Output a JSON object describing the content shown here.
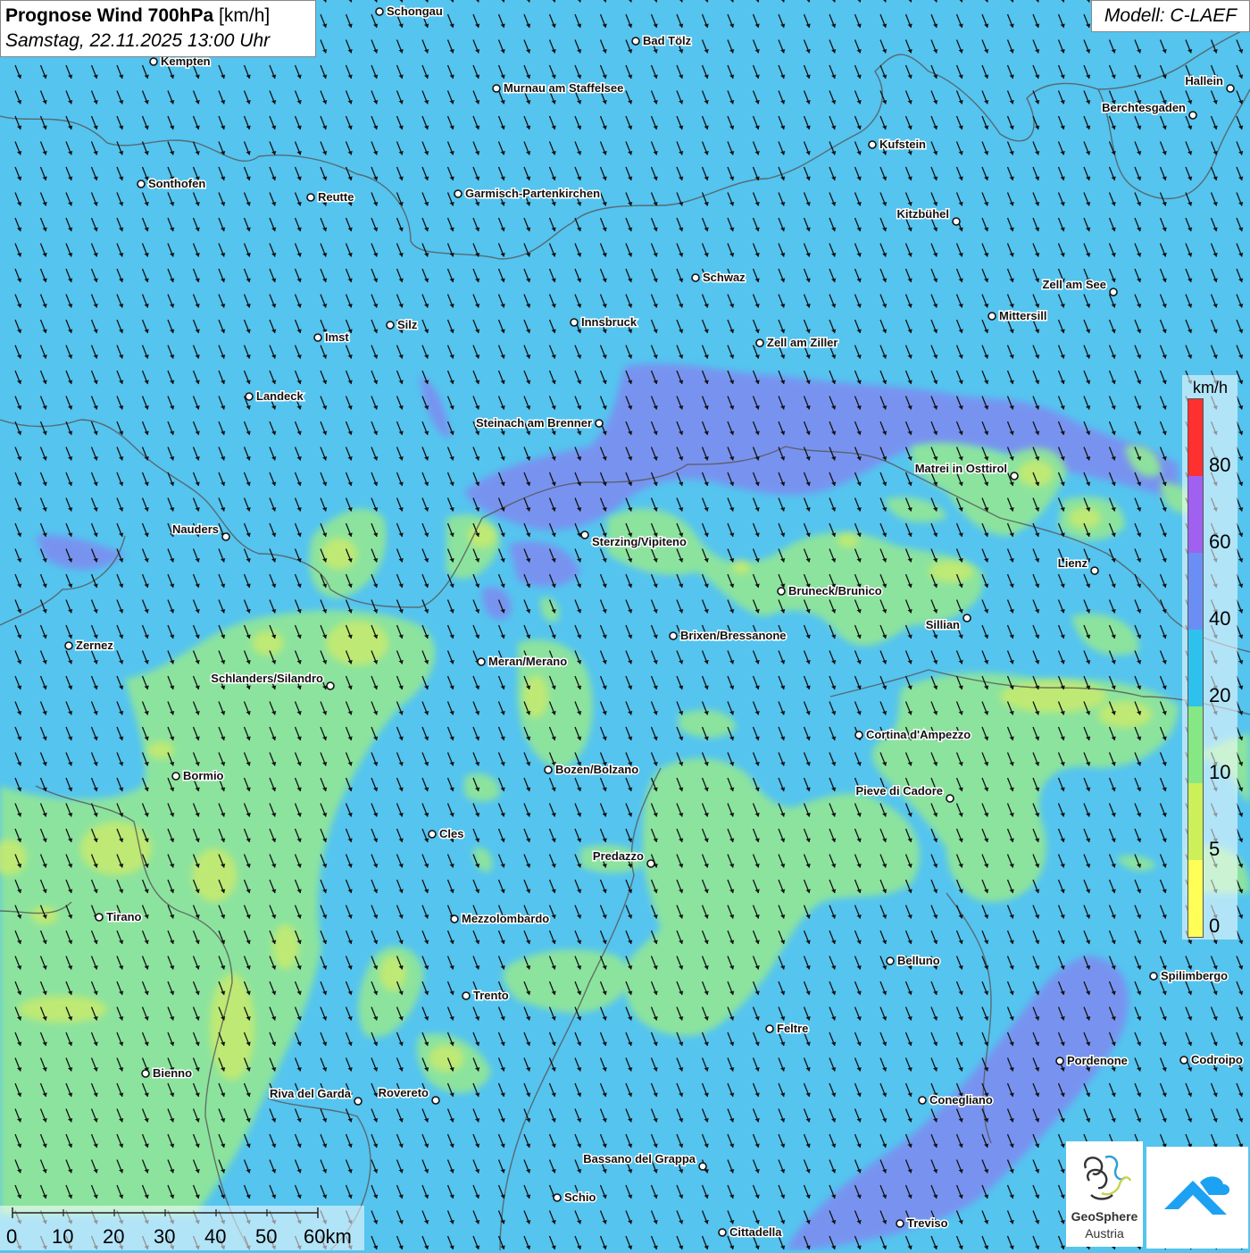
{
  "header": {
    "title_bold": "Prognose Wind 700hPa",
    "title_unit": "[km/h]",
    "datetime": "Samstag, 22.11.2025 13:00 Uhr",
    "model": "Modell: C-LAEF"
  },
  "legend": {
    "unit": "km/h",
    "ticks": [
      "80",
      "60",
      "40",
      "20",
      "10",
      "5",
      "0"
    ],
    "colors": [
      "#ff3030",
      "#a060f0",
      "#6b8ef5",
      "#2ec1ee",
      "#86e884",
      "#ccf05a",
      "#ffff58"
    ]
  },
  "scale": {
    "labels": [
      "0",
      "10",
      "20",
      "30",
      "40",
      "50",
      "60km"
    ]
  },
  "logos": {
    "geosphere_line1": "GeoSphere",
    "geosphere_line2": "Austria"
  },
  "cities": [
    {
      "name": "Schongau"
    },
    {
      "name": "Bad Tölz"
    },
    {
      "name": "Kempten"
    },
    {
      "name": "Murnau am Staffelsee"
    },
    {
      "name": "Hallein"
    },
    {
      "name": "Berchtesgaden"
    },
    {
      "name": "Kufstein"
    },
    {
      "name": "Sonthofen"
    },
    {
      "name": "Reutte"
    },
    {
      "name": "Garmisch-Partenkirchen"
    },
    {
      "name": "Kitzbühel"
    },
    {
      "name": "Schwaz"
    },
    {
      "name": "Zell am See"
    },
    {
      "name": "Mittersill"
    },
    {
      "name": "Imst"
    },
    {
      "name": "Silz"
    },
    {
      "name": "Innsbruck"
    },
    {
      "name": "Zell am Ziller"
    },
    {
      "name": "Landeck"
    },
    {
      "name": "Steinach am Brenner"
    },
    {
      "name": "Matrei in Osttirol"
    },
    {
      "name": "Nauders"
    },
    {
      "name": "Sterzing/Vipiteno"
    },
    {
      "name": "Lienz"
    },
    {
      "name": "Bruneck/Brunico"
    },
    {
      "name": "Sillian"
    },
    {
      "name": "Zernez"
    },
    {
      "name": "Brixen/Bressanone"
    },
    {
      "name": "Meran/Merano"
    },
    {
      "name": "Schlanders/Silandro"
    },
    {
      "name": "Cortina d'Ampezzo"
    },
    {
      "name": "Bozen/Bolzano"
    },
    {
      "name": "Bormio"
    },
    {
      "name": "Pieve di Cadore"
    },
    {
      "name": "Cles"
    },
    {
      "name": "Predazzo"
    },
    {
      "name": "Tirano"
    },
    {
      "name": "Mezzolombardo"
    },
    {
      "name": "Belluno"
    },
    {
      "name": "Spilimbergo"
    },
    {
      "name": "Trento"
    },
    {
      "name": "Feltre"
    },
    {
      "name": "Pordenone"
    },
    {
      "name": "Codroipo"
    },
    {
      "name": "Bienno"
    },
    {
      "name": "Riva del Garda"
    },
    {
      "name": "Rovereto"
    },
    {
      "name": "Conegliano"
    },
    {
      "name": "Bassano del Grappa"
    },
    {
      "name": "Schio"
    },
    {
      "name": "Treviso"
    },
    {
      "name": "Cittadella"
    }
  ]
}
